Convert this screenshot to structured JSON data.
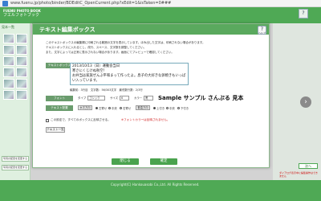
{
  "browser": {
    "url": "www.fuenu.jp/photo/binder/BDEditC_OpenCurrent.php?xEdit=1&isTaken=0###"
  },
  "app": {
    "logo_line1": "FUENU PHOTO BOOK",
    "logo_line2": "フエルフォトブック",
    "help_label": "?",
    "left_tag": "見本一覧",
    "left_button_1": "写真の配置を変更する",
    "left_button_2": "写真の配置を変更する",
    "side_note": "ダイアログ表示中に編集操作はできません",
    "side_button": "次へ",
    "copyright": "Copyright(C) Hankouasobi Co.,Ltd. All Rights Reserved."
  },
  "dialog": {
    "title": "テキスト編集ボックス",
    "help_icon_text": "?",
    "help_label": "ヘルプ",
    "intro_lines": [
      "このテキストボックスの編集欄に印刷される範囲の文字を表示しています。ほみ出した文字は、印刷されない場合があります。",
      "テキストボックスに入れるとし、改行、スペース、文字数を調整してください。",
      "また、文字によっては正常に表示されない場合があります。画面にてプレビューで確認してください。"
    ],
    "text_box_label": "テキストボックス",
    "text_value": "2013/10/13（日）運動会当日\n寒さにくじけぬ秋空！\nお弁当は家族ぜんぶ平和まって作ったよ。息子の大好きな卵焼きもいっぱい入っています。",
    "counts_text": "編集前：3行目　文字数：56/303文字　最低数行数：2/3行",
    "font_label": "フォント",
    "font_type_label": "タイプ",
    "font_type_value": "ゴシック",
    "font_size_label": "サイズ",
    "font_size_value": "6",
    "font_color_label": "カラー",
    "font_color_value": "黒",
    "sample_text": "Sample サンプル さんぷる 見本",
    "layout_label": "テキスト配置",
    "align_h_label": "水平方向",
    "align_h_opt1": "左寄せ",
    "align_h_opt2": "中央",
    "align_h_opt3": "右寄せ",
    "align_v_label": "垂直方向",
    "align_v_opt1": "上付き",
    "align_v_opt2": "中央",
    "align_v_opt3": "下付き",
    "checkbox_label": "この設定で、すべてのボックスに反映させる。",
    "warning_text": "※フォントカラーは反映されません。",
    "list_button": "テキスト一覧",
    "close_button": "閉じる",
    "confirm_button": "確定"
  },
  "colors": {
    "header_green": "#4fa955",
    "dialog_title": "#5aa95e",
    "warning_red": "#d01c1c"
  }
}
